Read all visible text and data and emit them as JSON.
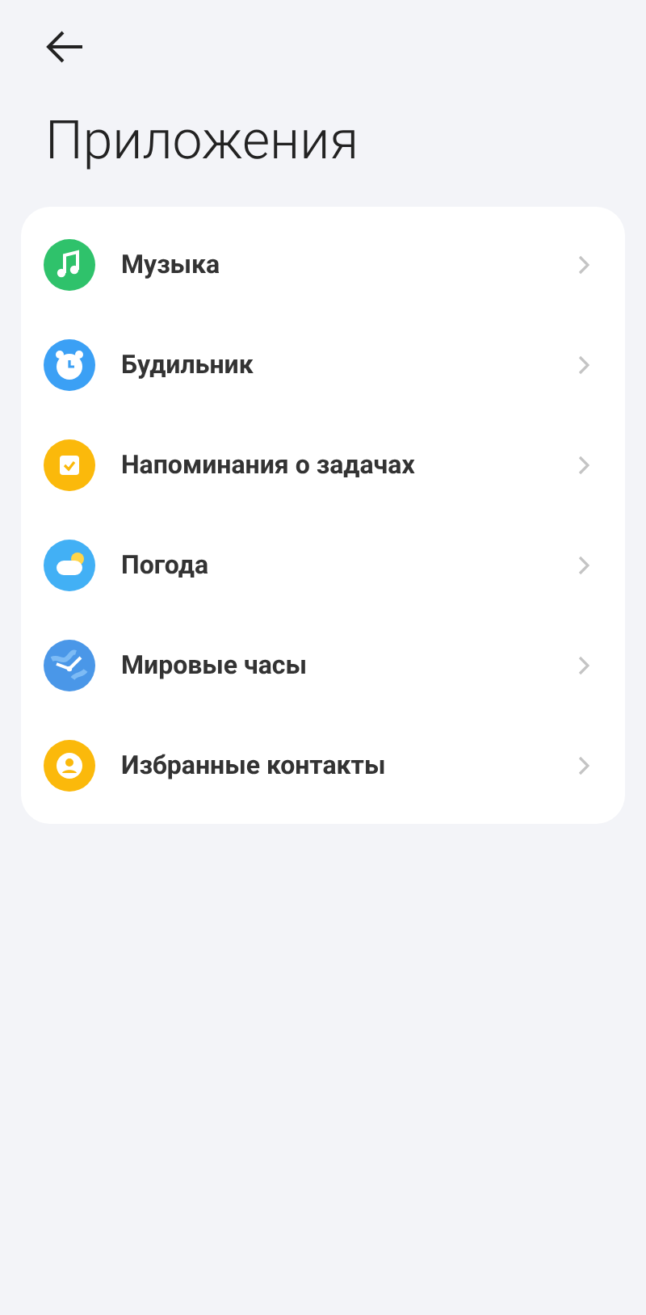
{
  "title": "Приложения",
  "items": [
    {
      "kind": "music",
      "label": "Музыка"
    },
    {
      "kind": "alarm",
      "label": "Будильник"
    },
    {
      "kind": "tasks",
      "label": "Напоминания о задачах"
    },
    {
      "kind": "weather",
      "label": "Погода"
    },
    {
      "kind": "clock",
      "label": "Мировые часы"
    },
    {
      "kind": "contacts",
      "label": "Избранные контакты"
    }
  ]
}
